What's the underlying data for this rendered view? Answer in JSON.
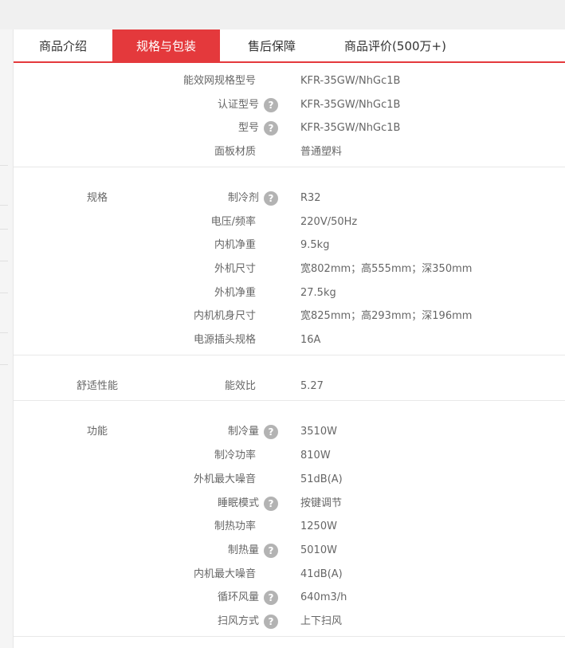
{
  "tabs": [
    {
      "label": "商品介绍",
      "active": false
    },
    {
      "label": "规格与包装",
      "active": true
    },
    {
      "label": "售后保障",
      "active": false
    },
    {
      "label": "商品评价(500万+)",
      "active": false
    }
  ],
  "colors": {
    "accent": "#e4393c",
    "help_icon": "#b3b3b3"
  },
  "sections": [
    {
      "group": "",
      "rows": [
        {
          "label": "能效网规格型号",
          "value": "KFR-35GW/NhGc1B",
          "help": false
        },
        {
          "label": "认证型号",
          "value": "KFR-35GW/NhGc1B",
          "help": true
        },
        {
          "label": "型号",
          "value": "KFR-35GW/NhGc1B",
          "help": true
        },
        {
          "label": "面板材质",
          "value": "普通塑料",
          "help": false
        }
      ]
    },
    {
      "group": "规格",
      "rows": [
        {
          "label": "制冷剂",
          "value": "R32",
          "help": true
        },
        {
          "label": "电压/频率",
          "value": "220V/50Hz",
          "help": false
        },
        {
          "label": "内机净重",
          "value": "9.5kg",
          "help": false
        },
        {
          "label": "外机尺寸",
          "value": "宽802mm；高555mm；深350mm",
          "help": false
        },
        {
          "label": "外机净重",
          "value": "27.5kg",
          "help": false
        },
        {
          "label": "内机机身尺寸",
          "value": "宽825mm；高293mm；深196mm",
          "help": false
        },
        {
          "label": "电源插头规格",
          "value": "16A",
          "help": false
        }
      ]
    },
    {
      "group": "舒适性能",
      "rows": [
        {
          "label": "能效比",
          "value": "5.27",
          "help": false
        }
      ]
    },
    {
      "group": "功能",
      "rows": [
        {
          "label": "制冷量",
          "value": "3510W",
          "help": true
        },
        {
          "label": "制冷功率",
          "value": "810W",
          "help": false
        },
        {
          "label": "外机最大噪音",
          "value": "51dB(A)",
          "help": false
        },
        {
          "label": "睡眠模式",
          "value": "按键调节",
          "help": true
        },
        {
          "label": "制热功率",
          "value": "1250W",
          "help": false
        },
        {
          "label": "制热量",
          "value": "5010W",
          "help": true
        },
        {
          "label": "内机最大噪音",
          "value": "41dB(A)",
          "help": false
        },
        {
          "label": "循环风量",
          "value": "640m3/h",
          "help": true
        },
        {
          "label": "扫风方式",
          "value": "上下扫风",
          "help": true
        }
      ]
    }
  ],
  "help_glyph": "?"
}
